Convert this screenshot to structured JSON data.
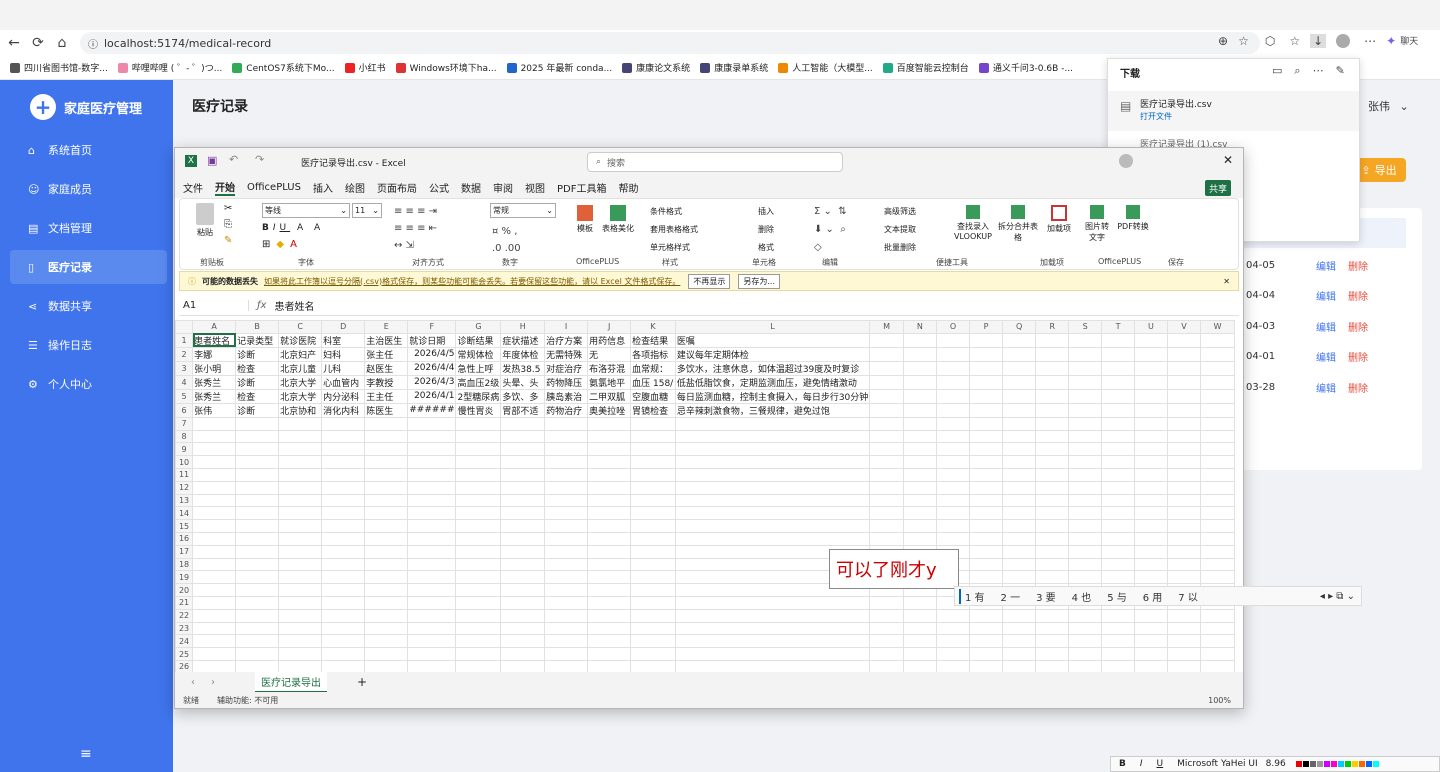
{
  "browser": {
    "url": "localhost:5174/medical-record",
    "bookmarks": [
      "四川省图书馆-数字...",
      "哔哩哔哩 ( ゜- ゜)つ...",
      "CentOS7系统下Mo...",
      "小红书",
      "Windows环境下ha...",
      "2025 年最新 conda...",
      "康康论文系统",
      "康康录单系统",
      "人工智能（大模型...",
      "百度智能云控制台",
      "通义千问3-0.6B -..."
    ],
    "chat_label": "聊天"
  },
  "downloads": {
    "title": "下载",
    "item1_name": "医疗记录导出.csv",
    "item1_action": "打开文件",
    "item2_name": "医疗记录导出 (1).csv"
  },
  "app": {
    "title": "家庭医疗管理",
    "menu": [
      "系统首页",
      "家庭成员",
      "文档管理",
      "医疗记录",
      "数据共享",
      "操作日志",
      "个人中心"
    ],
    "active_index": 3,
    "page_title": "医疗记录",
    "user": "张伟",
    "export_label": "导出",
    "rows": [
      {
        "date": "04-05",
        "edit": "编辑",
        "del": "删除"
      },
      {
        "date": "04-04",
        "edit": "编辑",
        "del": "删除"
      },
      {
        "date": "04-03",
        "edit": "编辑",
        "del": "删除"
      },
      {
        "date": "04-01",
        "edit": "编辑",
        "del": "删除"
      },
      {
        "date": "03-28",
        "edit": "编辑",
        "del": "删除"
      }
    ]
  },
  "excel": {
    "title": "医疗记录导出.csv  -  Excel",
    "search_placeholder": "搜索",
    "share_label": "共享",
    "tabs": [
      "文件",
      "开始",
      "OfficePLUS",
      "插入",
      "绘图",
      "页面布局",
      "公式",
      "数据",
      "审阅",
      "视图",
      "PDF工具箱",
      "帮助"
    ],
    "active_tab": "开始",
    "ribbon": {
      "paste": "粘贴",
      "font_name": "等线",
      "font_size": "11",
      "number_format": "常规",
      "templates": "模板",
      "table_beauty": "表格美化",
      "cond_fmt": "条件格式",
      "table_fmt": "套用表格格式",
      "cell_style": "单元格样式",
      "insert": "插入",
      "delete": "删除",
      "format": "格式",
      "adv_filter": "高级筛选",
      "text_extract": "文本提取",
      "batch_delete": "批量删除",
      "lookup": "查找录入VLOOKUP",
      "split_merge": "拆分合并表格",
      "addin": "加载项",
      "img2text": "图片转文字",
      "pdf_convert": "PDF转换",
      "groups": [
        "剪贴板",
        "字体",
        "对齐方式",
        "数字",
        "OfficePLUS",
        "样式",
        "单元格",
        "编辑",
        "便捷工具",
        "加载项",
        "OfficePLUS",
        "保存"
      ]
    },
    "info": {
      "label": "可能的数据丢失",
      "message": "如果将此工作簿以逗号分隔(.csv)格式保存，则某些功能可能会丢失。若要保留这些功能，请以 Excel 文件格式保存。",
      "btn_no_show": "不再显示",
      "btn_save_as": "另存为..."
    },
    "name_box": "A1",
    "formula": "患者姓名",
    "columns": [
      "A",
      "B",
      "C",
      "D",
      "E",
      "F",
      "G",
      "H",
      "I",
      "J",
      "K",
      "L",
      "M",
      "N",
      "O",
      "P",
      "Q",
      "R",
      "S",
      "T",
      "U",
      "V",
      "W"
    ],
    "rows": [
      [
        "患者姓名",
        "记录类型",
        "就诊医院",
        "科室",
        "主治医生",
        "就诊日期",
        "诊断结果",
        "症状描述",
        "治疗方案",
        "用药信息",
        "检查结果",
        "医嘱"
      ],
      [
        "李娜",
        "诊断",
        "北京妇产",
        "妇科",
        "张主任",
        "2026/4/5",
        "常规体检",
        "年度体检",
        "无需特殊",
        "无",
        "各项指标",
        "建议每年定期体检"
      ],
      [
        "张小明",
        "检查",
        "北京儿童",
        "儿科",
        "赵医生",
        "2026/4/4",
        "急性上呼",
        "发热38.5",
        "对症治疗",
        "布洛芬混",
        "血常规：",
        "多饮水，注意休息，如体温超过39度及时复诊"
      ],
      [
        "张秀兰",
        "诊断",
        "北京大学",
        "心血管内",
        "李教授",
        "2026/4/3",
        "高血压2级",
        "头晕、头",
        "药物降压",
        "氨氯地平",
        "血压 158/",
        "低盐低脂饮食，定期监测血压，避免情绪激动"
      ],
      [
        "张秀兰",
        "检查",
        "北京大学",
        "内分泌科",
        "王主任",
        "2026/4/1",
        "2型糖尿病",
        "多饮、多",
        "胰岛素治",
        "二甲双胍",
        "空腹血糖",
        "每日监测血糖，控制主食摄入，每日步行30分钟"
      ],
      [
        "张伟",
        "诊断",
        "北京协和",
        "消化内科",
        "陈医生",
        "######",
        "慢性胃炎",
        "胃部不适",
        "药物治疗",
        "奥美拉唑",
        "胃镜检查",
        "忌辛辣刺激食物，三餐规律，避免过饱"
      ]
    ],
    "row_count": 26,
    "sheet_tab": "医疗记录导出",
    "status_ready": "就绪",
    "accessibility": "辅助功能: 不可用",
    "zoom": "100%"
  },
  "ime": {
    "composition": "可以了刚才y",
    "candidates": [
      "1 有",
      "2 一",
      "3 要",
      "4 也",
      "5 与",
      "6 用",
      "7 以"
    ]
  },
  "format_toolbar": {
    "font": "Microsoft YaHei UI",
    "size": "8.96",
    "bold": "B",
    "italic": "I",
    "underline": "U"
  }
}
